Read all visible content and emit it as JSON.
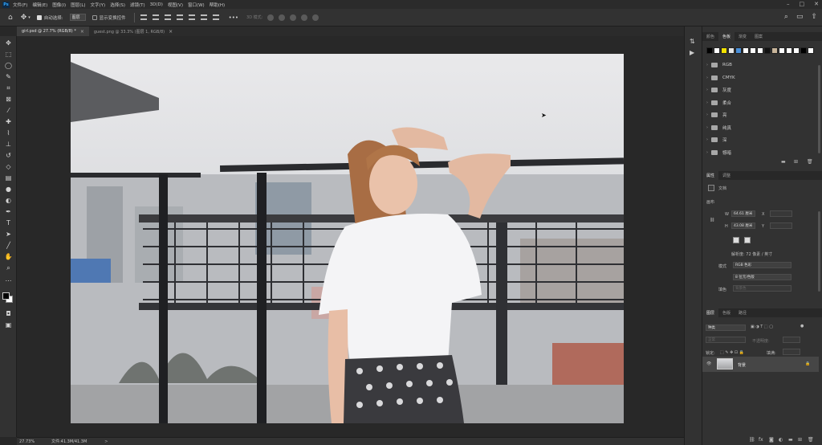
{
  "menu": [
    "文件(F)",
    "编辑(E)",
    "图像(I)",
    "图层(L)",
    "文字(Y)",
    "选择(S)",
    "滤镜(T)",
    "3D(D)",
    "视图(V)",
    "窗口(W)",
    "帮助(H)"
  ],
  "app_logo": "Ps",
  "options_bar": {
    "auto_select_label": "自动选择:",
    "auto_select_target": "图层",
    "show_transform_label": "显示变换控件",
    "mode_3d_label": "3D 模式:"
  },
  "tabs": [
    {
      "label": "girl.psd @ 27.7% (RGB/8) *"
    },
    {
      "label": "guest.png @ 33.3% (图层 1, RGB/8)"
    }
  ],
  "status": {
    "zoom": "27.73%",
    "doc_size": "文件:41.3M/41.3M",
    "arrow": ">"
  },
  "swatches_panel": {
    "tabs": [
      "颜色",
      "色板",
      "渐变",
      "图案"
    ],
    "active_tab": 1,
    "colors": [
      "#000000",
      "#ffffff",
      "#f2e200",
      "#e8e8e8",
      "#4a90d9",
      "#ffffff",
      "#ffffff",
      "#ffffff",
      "#111111",
      "#c8b59a",
      "#ffffff",
      "#ffffff",
      "#ffffff",
      "#000000",
      "#ffffff"
    ],
    "groups": [
      "RGB",
      "CMYK",
      "灰度",
      "柔合",
      "亮",
      "纯真",
      "深",
      "憾暗"
    ]
  },
  "properties_panel": {
    "tabs": [
      "属性",
      "调整"
    ],
    "active_tab": 0,
    "doc_label": "文档",
    "canvas_section": "画布",
    "w_label": "W",
    "w_value": "64.61 厘米",
    "h_label": "H",
    "h_value": "43.08 厘米",
    "x_label": "X",
    "y_label": "Y",
    "resolution": "解析度: 72 像素 / 英寸",
    "mode_label": "模式",
    "mode_value": "RGB 色彩",
    "depth_value": "8 位元/色版",
    "fill_label": "填色",
    "fill_value": "背景色"
  },
  "layers_panel": {
    "tabs": [
      "图层",
      "色版",
      "路径"
    ],
    "active_tab": 0,
    "filter_label": "种类",
    "blend_label": "正常",
    "opacity_label": "不透明度:",
    "lock_label": "锁定:",
    "fill_label": "填满:",
    "layer_name": "背景"
  }
}
